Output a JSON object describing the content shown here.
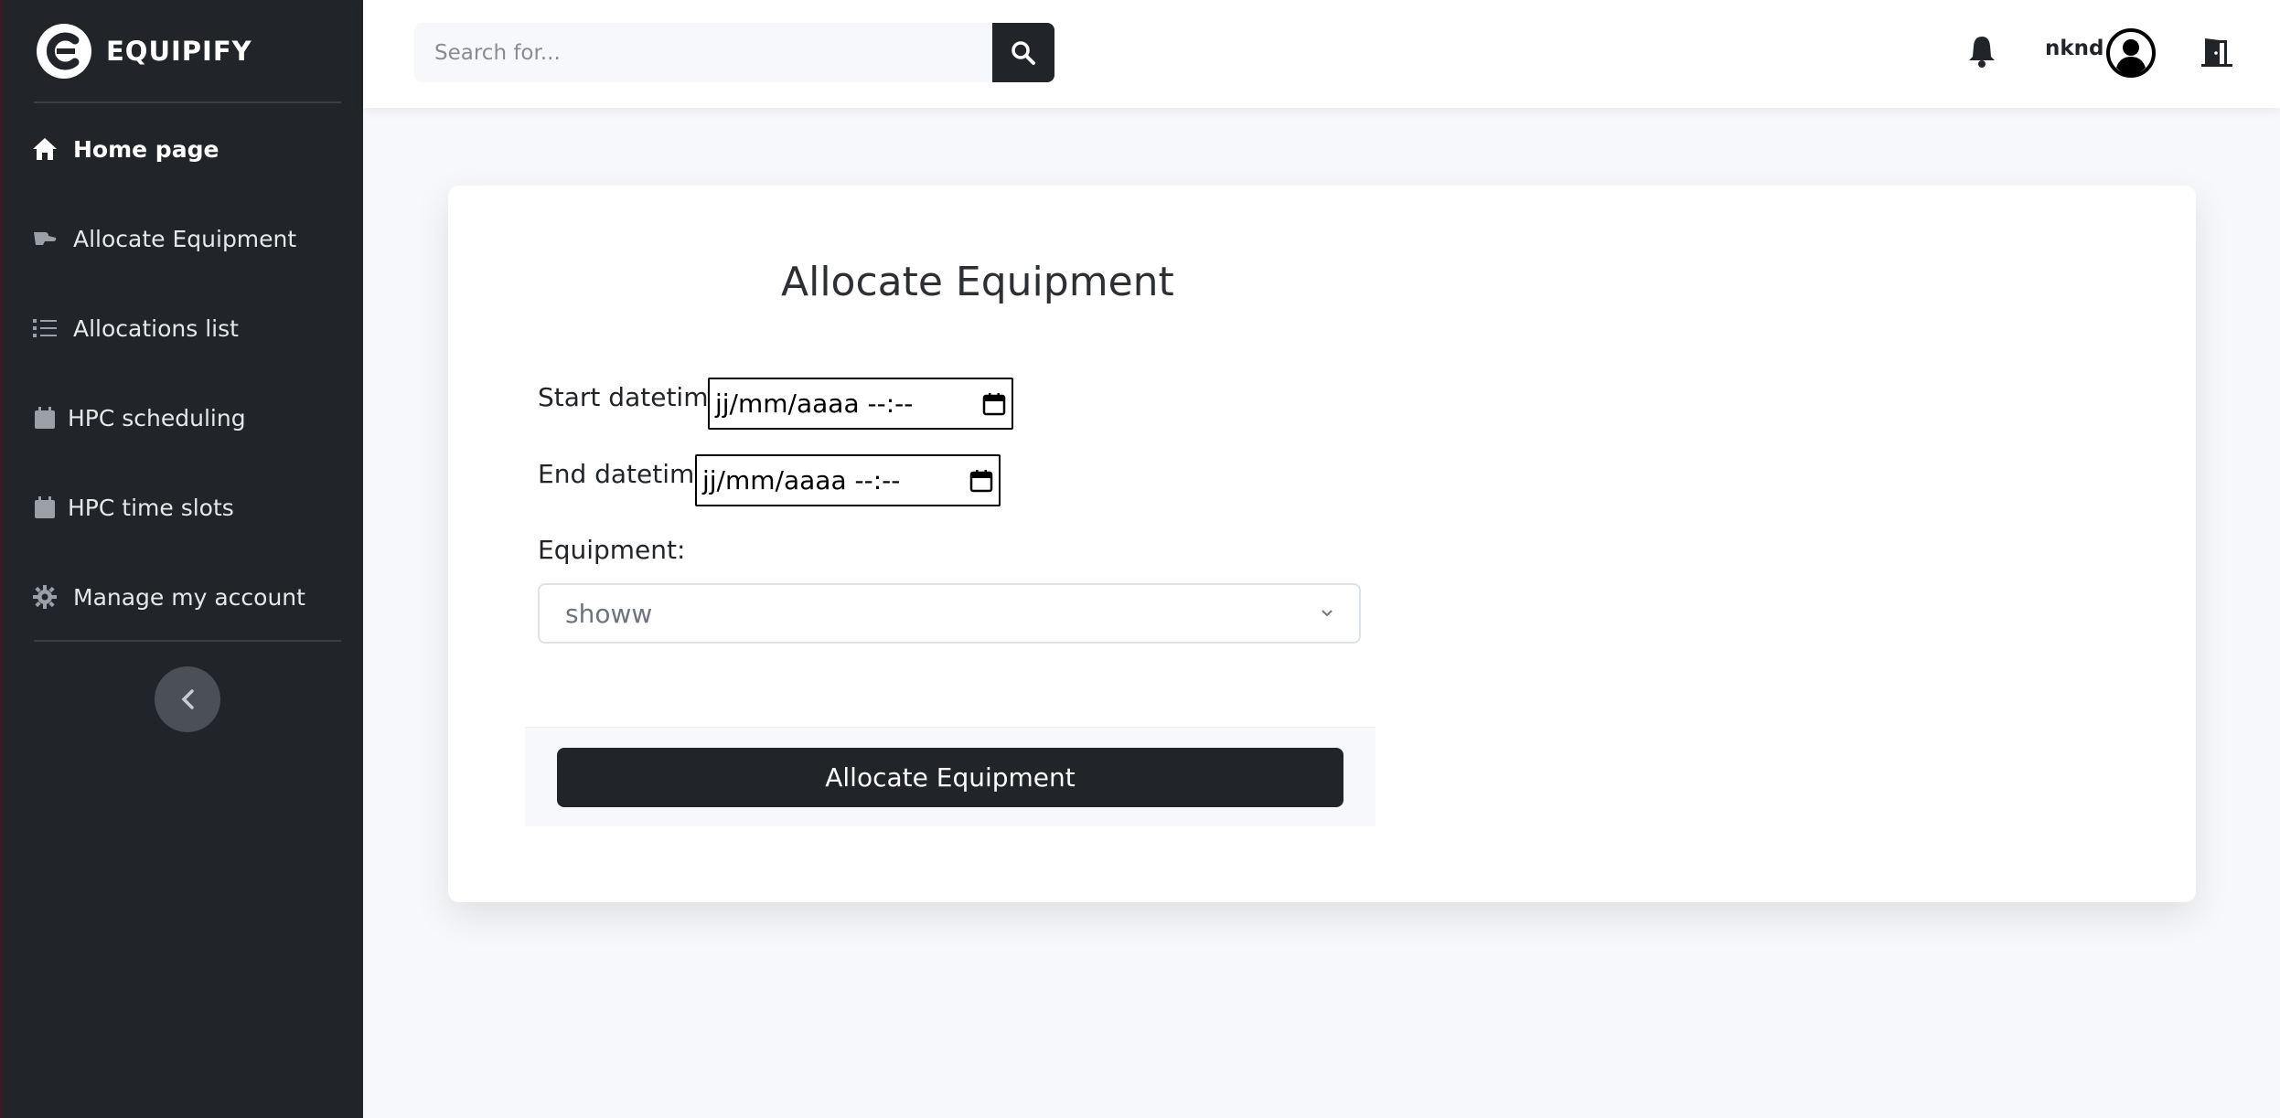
{
  "brand": {
    "name": "EQUIPIFY"
  },
  "sidebar": {
    "items": [
      {
        "label": "Home page",
        "icon": "home-icon"
      },
      {
        "label": "Allocate Equipment",
        "icon": "hand-holding-icon"
      },
      {
        "label": "Allocations list",
        "icon": "list-icon"
      },
      {
        "label": "HPC scheduling",
        "icon": "calendar-icon"
      },
      {
        "label": "HPC time slots",
        "icon": "calendar-icon"
      },
      {
        "label": "Manage my account",
        "icon": "gear-icon"
      }
    ],
    "collapse_icon": "chevron-left-icon"
  },
  "topbar": {
    "search_placeholder": "Search for...",
    "username": "nknd"
  },
  "form": {
    "title": "Allocate Equipment",
    "start_label": "Start datetime:",
    "start_value": "jj/mm/aaaa  --:--",
    "end_label": "End datetime:",
    "end_value": "jj/mm/aaaa  --:--",
    "equipment_label": "Equipment:",
    "equipment_value": "showw",
    "submit_label": "Allocate Equipment"
  },
  "colors": {
    "sidebar_bg": "#212529",
    "page_bg": "#f7f8fc",
    "button_bg": "#212529"
  }
}
